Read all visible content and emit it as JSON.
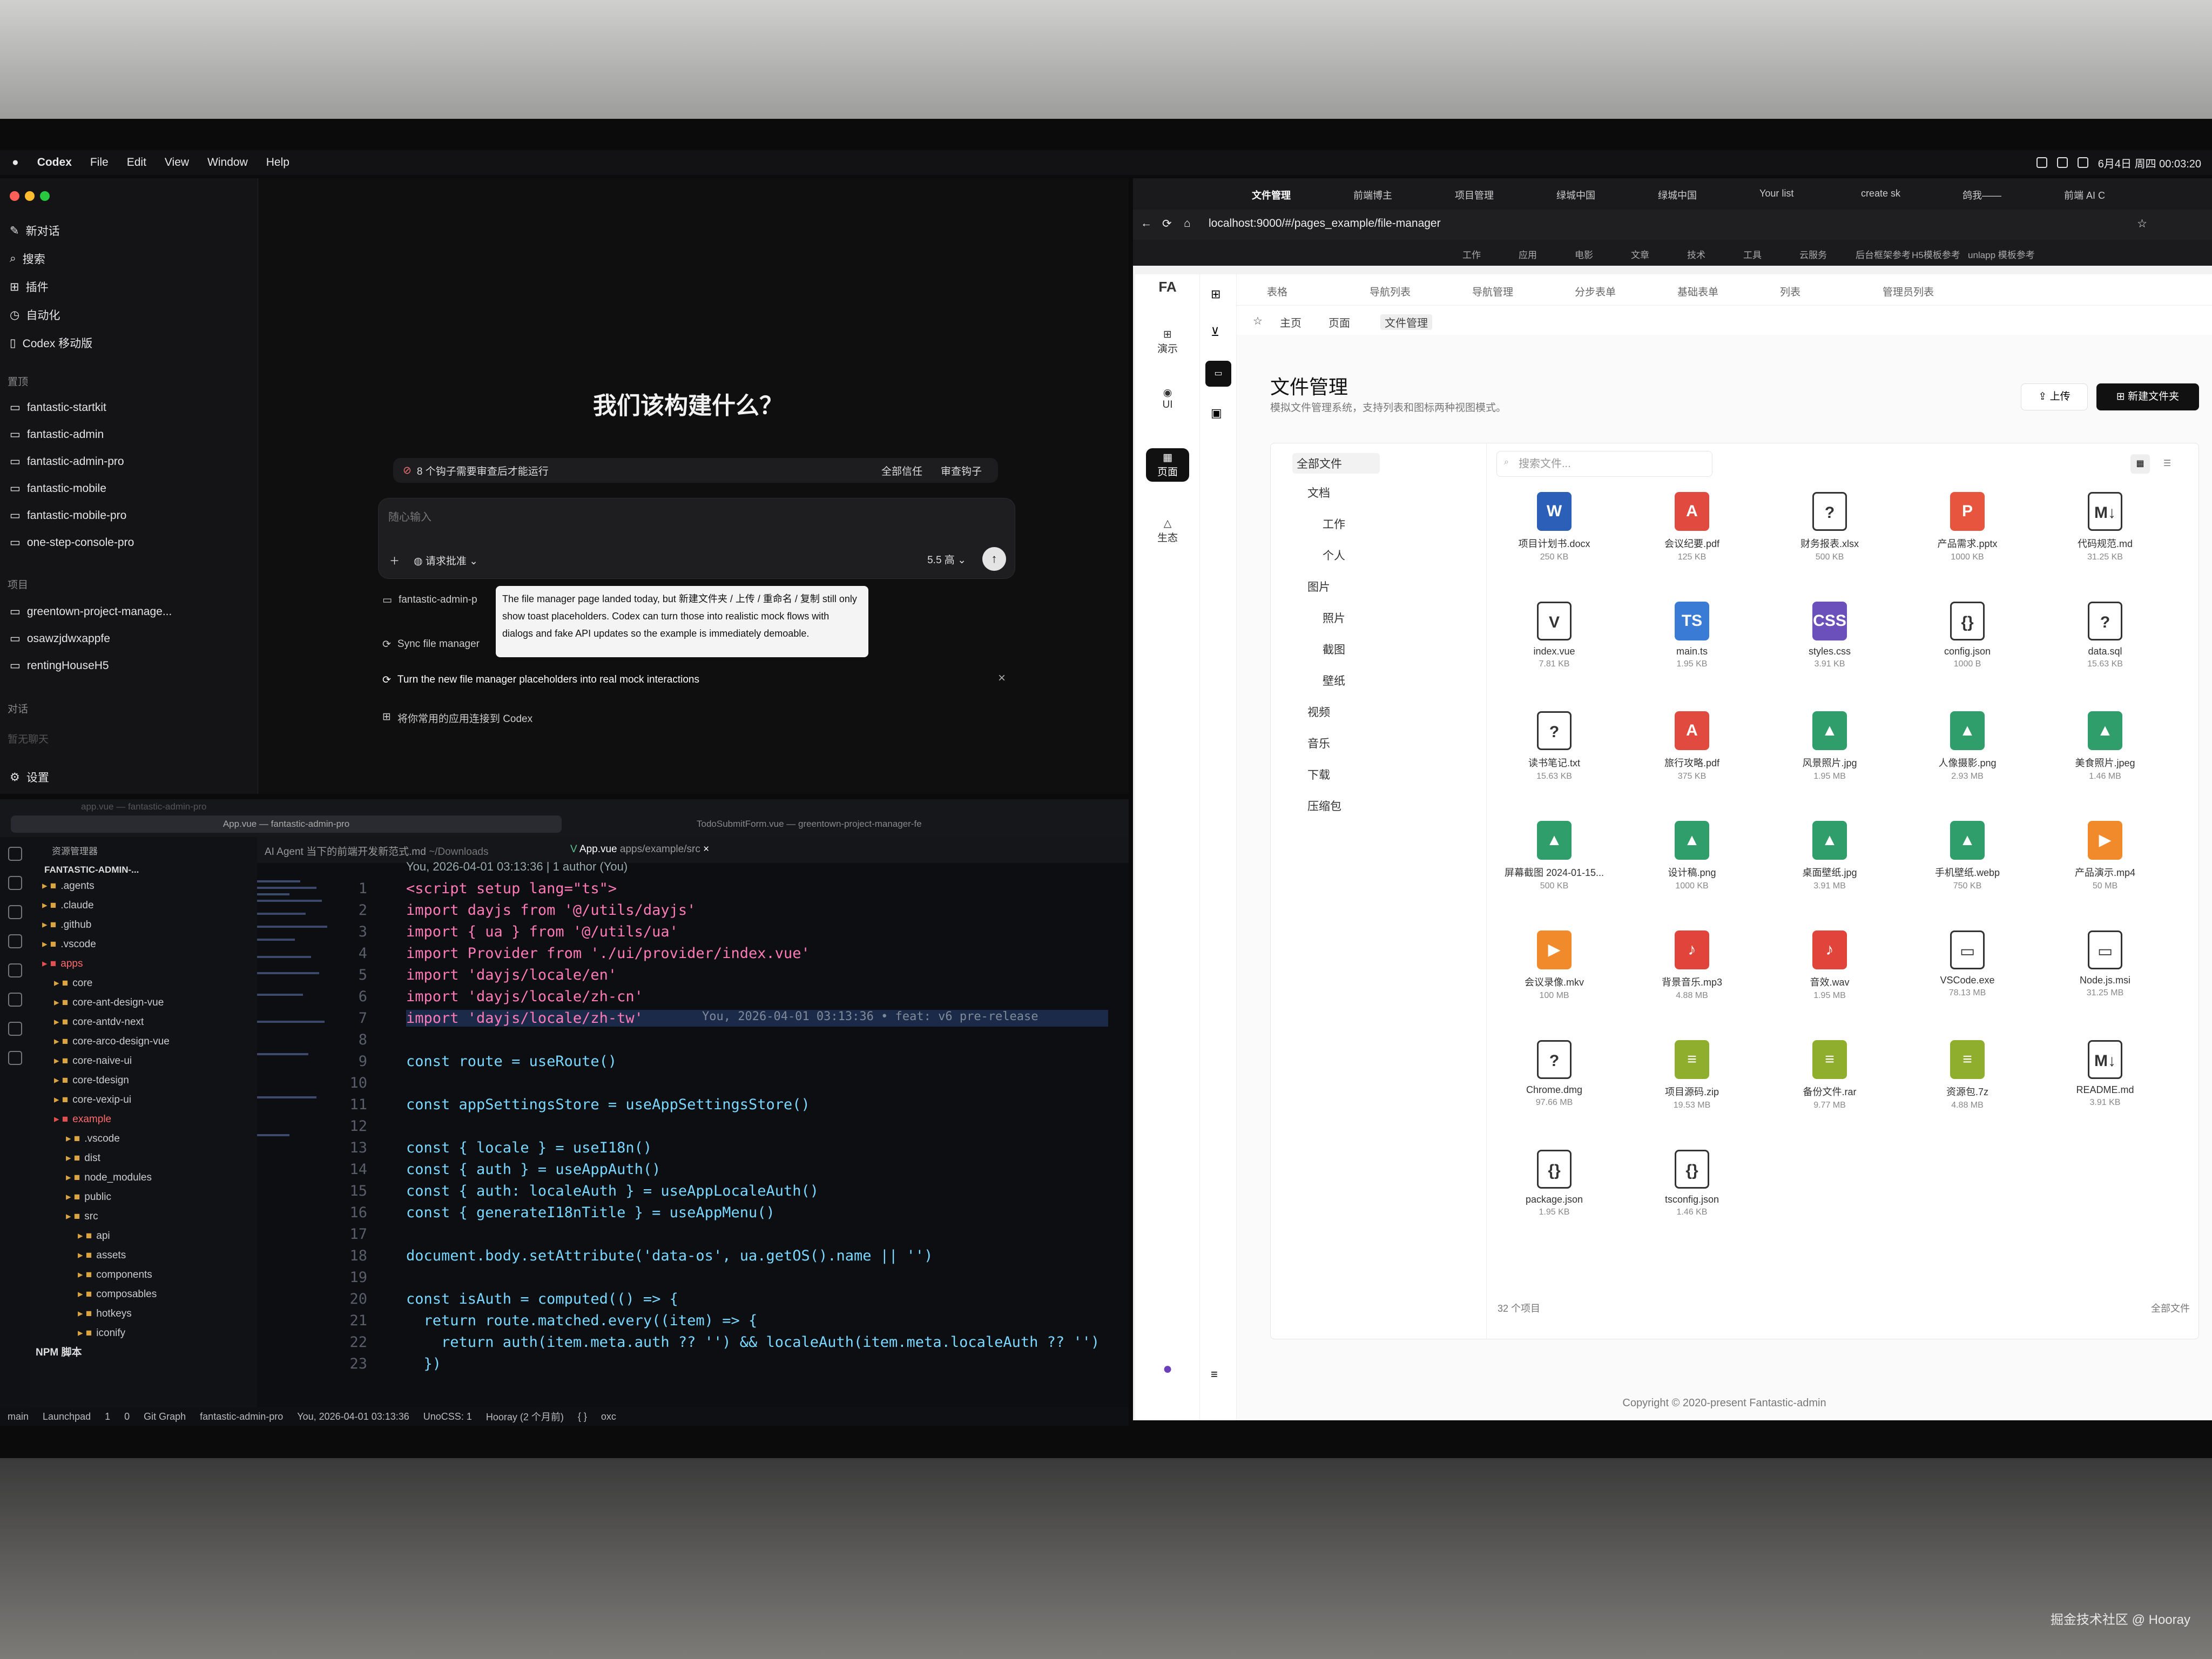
{
  "menubar": {
    "app": "Codex",
    "items": [
      "File",
      "Edit",
      "View",
      "Window",
      "Help"
    ],
    "clock": "6月4日 周四 00:03:20"
  },
  "codex": {
    "nav": [
      "新对话",
      "搜索",
      "插件",
      "自动化",
      "Codex 移动版"
    ],
    "sec_projects": "置顶",
    "pinned": [
      "fantastic-startkit",
      "fantastic-admin",
      "fantastic-admin-pro",
      "fantastic-mobile",
      "fantastic-mobile-pro",
      "one-step-console-pro"
    ],
    "sec_items": "项目",
    "projects": [
      "greentown-project-manage...",
      "osawzjdwxappfe",
      "rentingHouseH5"
    ],
    "sec_chat": "对话",
    "no_chat": "暂无聊天",
    "settings": "设置",
    "headline": "我们该构建什么？",
    "hook_warning": "8 个钩子需要审查后才能运行",
    "trust_all": "全部信任",
    "review_hooks": "审查钩子",
    "placeholder": "随心输入",
    "approval": "请求批准",
    "model": "5.5 高",
    "sugg1": "fantastic-admin-p",
    "sugg2": "Sync file manager",
    "sugg3": "Turn the new file manager placeholders into real mock interactions",
    "sugg4": "将你常用的应用连接到 Codex",
    "tooltip": "The file manager page landed today, but 新建文件夹 / 上传 / 重命名 / 复制 still only show toast placeholders. Codex can turn those into realistic mock flows with dialogs and fake API updates so the example is immediately demoable."
  },
  "vscode": {
    "window_tabs": [
      "App.vue — fantastic-admin-pro",
      "TodoSubmitForm.vue — greentown-project-manager-fe"
    ],
    "faded_tab": "app.vue — fantastic-admin-pro",
    "explorer_title": "资源管理器",
    "root": "FANTASTIC-ADMIN-...",
    "tree": [
      ".agents",
      ".claude",
      ".github",
      ".vscode",
      "apps",
      "core",
      "core-ant-design-vue",
      "core-antdv-next",
      "core-arco-design-vue",
      "core-naive-ui",
      "core-tdesign",
      "core-vexip-ui",
      "example",
      ".vscode",
      "dist",
      "node_modules",
      "public",
      "src",
      "api",
      "assets",
      "components",
      "composables",
      "hotkeys",
      "iconify"
    ],
    "npm": "NPM 脚本",
    "tab1": "AI Agent 当下的前端开发新范式.md",
    "tab1_path": "~/Downloads",
    "tab2": "App.vue",
    "tab2_path": "apps/example/src",
    "blame": "You, 2026-04-01 03:13:36 | 1 author (You)",
    "inline_blame": "You, 2026-04-01 03:13:36 • feat: v6 pre-release",
    "status": [
      "main",
      "Launchpad",
      "1",
      "0",
      "Git Graph",
      "fantastic-admin-pro",
      "You, 2026-04-01 03:13:36",
      "UnoCSS: 1",
      "Hooray (2 个月前)",
      "{ }",
      "oxc"
    ],
    "lines": [
      "<script setup lang=\"ts\">",
      "import dayjs from '@/utils/dayjs'",
      "import { ua } from '@/utils/ua'",
      "import Provider from './ui/provider/index.vue'",
      "import 'dayjs/locale/en'",
      "import 'dayjs/locale/zh-cn'",
      "import 'dayjs/locale/zh-tw'",
      "",
      "const route = useRoute()",
      "",
      "const appSettingsStore = useAppSettingsStore()",
      "",
      "const { locale } = useI18n()",
      "const { auth } = useAppAuth()",
      "const { auth: localeAuth } = useAppLocaleAuth()",
      "const { generateI18nTitle } = useAppMenu()",
      "",
      "document.body.setAttribute('data-os', ua.getOS().name || '')",
      "",
      "const isAuth = computed(() => {",
      "  return route.matched.every((item) => {",
      "    return auth(item.meta.auth ?? '') && localeAuth(item.meta.localeAuth ?? '')",
      "  })"
    ]
  },
  "browser": {
    "tabs": [
      "文件管理",
      "前端博主",
      "项目管理",
      "绿城中国",
      "绿城中国",
      "Your list",
      "create sk",
      "鸽我——",
      "前端 AI C"
    ],
    "url": "localhost:9000/#/pages_example/file-manager",
    "bookmarks": [
      "工作",
      "应用",
      "电影",
      "文章",
      "技术",
      "工具",
      "云服务",
      "后台框架参考",
      "H5模板参考",
      "unlapp 模板参考"
    ],
    "app_tabs": [
      "表格",
      "导航列表",
      "导航管理",
      "分步表单",
      "基础表单",
      "列表",
      "管理员列表"
    ],
    "rail": [
      "演示",
      "UI",
      "页面",
      "生态"
    ],
    "crumbs": [
      "主页",
      "页面",
      "文件管理"
    ],
    "title": "文件管理",
    "desc": "模拟文件管理系统，支持列表和图标两种视图模式。",
    "upload": "上传",
    "new_folder": "新建文件夹",
    "tree": [
      "全部文件",
      "文档",
      "工作",
      "个人",
      "图片",
      "照片",
      "截图",
      "壁纸",
      "视频",
      "音乐",
      "下载",
      "压缩包"
    ],
    "search_placeholder": "搜索文件...",
    "files": [
      {
        "name": "项目计划书.docx",
        "size": "250 KB",
        "icon": "word-icon",
        "color": "#2b5fb8",
        "glyph": "W"
      },
      {
        "name": "会议纪要.pdf",
        "size": "125 KB",
        "icon": "pdf-icon",
        "color": "#e04a3f",
        "glyph": "A"
      },
      {
        "name": "财务报表.xlsx",
        "size": "500 KB",
        "icon": "unknown-file-icon",
        "color": "#ffffff",
        "glyph": "?"
      },
      {
        "name": "产品需求.pptx",
        "size": "1000 KB",
        "icon": "ppt-icon",
        "color": "#e8553f",
        "glyph": "P"
      },
      {
        "name": "代码规范.md",
        "size": "31.25 KB",
        "icon": "markdown-icon",
        "color": "#ffffff",
        "glyph": "M↓"
      },
      {
        "name": "index.vue",
        "size": "7.81 KB",
        "icon": "vue-icon",
        "color": "#ffffff",
        "glyph": "V"
      },
      {
        "name": "main.ts",
        "size": "1.95 KB",
        "icon": "typescript-icon",
        "color": "#3a7bd5",
        "glyph": "TS"
      },
      {
        "name": "styles.css",
        "size": "3.91 KB",
        "icon": "css-icon",
        "color": "#6b4fbb",
        "glyph": "CSS"
      },
      {
        "name": "config.json",
        "size": "1000 B",
        "icon": "json-icon",
        "color": "#ffffff",
        "glyph": "{}"
      },
      {
        "name": "data.sql",
        "size": "15.63 KB",
        "icon": "unknown-file-icon",
        "color": "#ffffff",
        "glyph": "?"
      },
      {
        "name": "读书笔记.txt",
        "size": "15.63 KB",
        "icon": "unknown-file-icon",
        "color": "#ffffff",
        "glyph": "?"
      },
      {
        "name": "旅行攻略.pdf",
        "size": "375 KB",
        "icon": "pdf-icon",
        "color": "#e04a3f",
        "glyph": "A"
      },
      {
        "name": "风景照片.jpg",
        "size": "1.95 MB",
        "icon": "image-icon",
        "color": "#2f9e6a",
        "glyph": "▲"
      },
      {
        "name": "人像摄影.png",
        "size": "2.93 MB",
        "icon": "image-icon",
        "color": "#2f9e6a",
        "glyph": "▲"
      },
      {
        "name": "美食照片.jpeg",
        "size": "1.46 MB",
        "icon": "image-icon",
        "color": "#2f9e6a",
        "glyph": "▲"
      },
      {
        "name": "屏幕截图 2024-01-15...",
        "size": "500 KB",
        "icon": "image-icon",
        "color": "#2f9e6a",
        "glyph": "▲"
      },
      {
        "name": "设计稿.png",
        "size": "1000 KB",
        "icon": "image-icon",
        "color": "#2f9e6a",
        "glyph": "▲"
      },
      {
        "name": "桌面壁纸.jpg",
        "size": "3.91 MB",
        "icon": "image-icon",
        "color": "#2f9e6a",
        "glyph": "▲"
      },
      {
        "name": "手机壁纸.webp",
        "size": "750 KB",
        "icon": "image-icon",
        "color": "#2f9e6a",
        "glyph": "▲"
      },
      {
        "name": "产品演示.mp4",
        "size": "50 MB",
        "icon": "video-icon",
        "color": "#f08a2a",
        "glyph": "▶"
      },
      {
        "name": "会议录像.mkv",
        "size": "100 MB",
        "icon": "video-icon",
        "color": "#f08a2a",
        "glyph": "▶"
      },
      {
        "name": "背景音乐.mp3",
        "size": "4.88 MB",
        "icon": "music-icon",
        "color": "#e0443a",
        "glyph": "♪"
      },
      {
        "name": "音效.wav",
        "size": "1.95 MB",
        "icon": "music-icon",
        "color": "#e0443a",
        "glyph": "♪"
      },
      {
        "name": "VSCode.exe",
        "size": "78.13 MB",
        "icon": "app-window-icon",
        "color": "#ffffff",
        "glyph": "▭"
      },
      {
        "name": "Node.js.msi",
        "size": "31.25 MB",
        "icon": "app-window-icon",
        "color": "#ffffff",
        "glyph": "▭"
      },
      {
        "name": "Chrome.dmg",
        "size": "97.66 MB",
        "icon": "unknown-file-icon",
        "color": "#ffffff",
        "glyph": "?"
      },
      {
        "name": "项目源码.zip",
        "size": "19.53 MB",
        "icon": "archive-icon",
        "color": "#8fae2e",
        "glyph": "≡"
      },
      {
        "name": "备份文件.rar",
        "size": "9.77 MB",
        "icon": "archive-icon",
        "color": "#8fae2e",
        "glyph": "≡"
      },
      {
        "name": "资源包.7z",
        "size": "4.88 MB",
        "icon": "archive-icon",
        "color": "#8fae2e",
        "glyph": "≡"
      },
      {
        "name": "README.md",
        "size": "3.91 KB",
        "icon": "markdown-icon",
        "color": "#ffffff",
        "glyph": "M↓"
      },
      {
        "name": "package.json",
        "size": "1.95 KB",
        "icon": "json-icon",
        "color": "#ffffff",
        "glyph": "{}"
      },
      {
        "name": "tsconfig.json",
        "size": "1.46 KB",
        "icon": "json-icon",
        "color": "#ffffff",
        "glyph": "{}"
      }
    ],
    "count": "32 个项目",
    "all_files_label": "全部文件",
    "footer": "Copyright © 2020-present Fantastic-admin"
  },
  "watermark": "掘金技术社区 @ Hooray"
}
